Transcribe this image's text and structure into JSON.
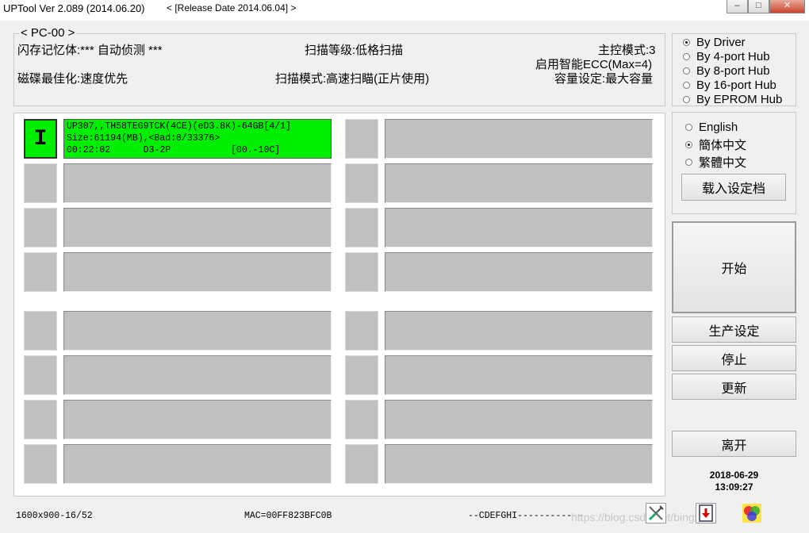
{
  "window": {
    "title": "UPTool Ver 2.089 (2014.06.20)",
    "release": "< [Release Date 2014.06.04] >",
    "minimize": "–",
    "maximize": "□",
    "close": "✕"
  },
  "info": {
    "group_label": "< PC-00 >",
    "flash_memory": "闪存记忆体:*** 自动侦测 ***",
    "scan_level": "扫描等级:低格扫描",
    "master_mode": "主控模式:3",
    "ecc": "启用智能ECC(Max=4)",
    "disk_opt": "磁碟最佳化:速度优先",
    "scan_mode": "扫描模式:高速扫瞄(正片使用)",
    "capacity": "容量设定:最大容量"
  },
  "mode_options": [
    {
      "label": "By Driver",
      "selected": true
    },
    {
      "label": "By 4-port Hub",
      "selected": false
    },
    {
      "label": "By 8-port Hub",
      "selected": false
    },
    {
      "label": "By 16-port Hub",
      "selected": false
    },
    {
      "label": "By EPROM Hub",
      "selected": false
    }
  ],
  "language_options": [
    {
      "label": "English",
      "selected": false
    },
    {
      "label": "簡体中文",
      "selected": true
    },
    {
      "label": "繁體中文",
      "selected": false
    }
  ],
  "buttons": {
    "load_settings": "载入设定档",
    "start": "开始",
    "production_settings": "生产设定",
    "stop": "停止",
    "update": "更新",
    "exit": "离开"
  },
  "ports": {
    "active_id": "I",
    "active_line1": "UP307,,TH58TEG9TCK(4CE)(eD3.8K)-64GB[4/1]",
    "active_line2": "Size:61194(MB),<Bad:8/33376>",
    "active_line3": "00:22:02      D3-2P           [00.-10C]"
  },
  "status": {
    "resolution": "1600x900-16/52",
    "mac": "MAC=00FF823BFC0B",
    "drives": "--CDEFGHI------------",
    "watermark": "https://blog.csdn.net/bingrez"
  },
  "datetime": {
    "date": "2018-06-29",
    "time": "13:09:27"
  },
  "icons": {
    "tools": "tools-icon",
    "download": "download-icon",
    "colors": "color-circles-icon"
  }
}
